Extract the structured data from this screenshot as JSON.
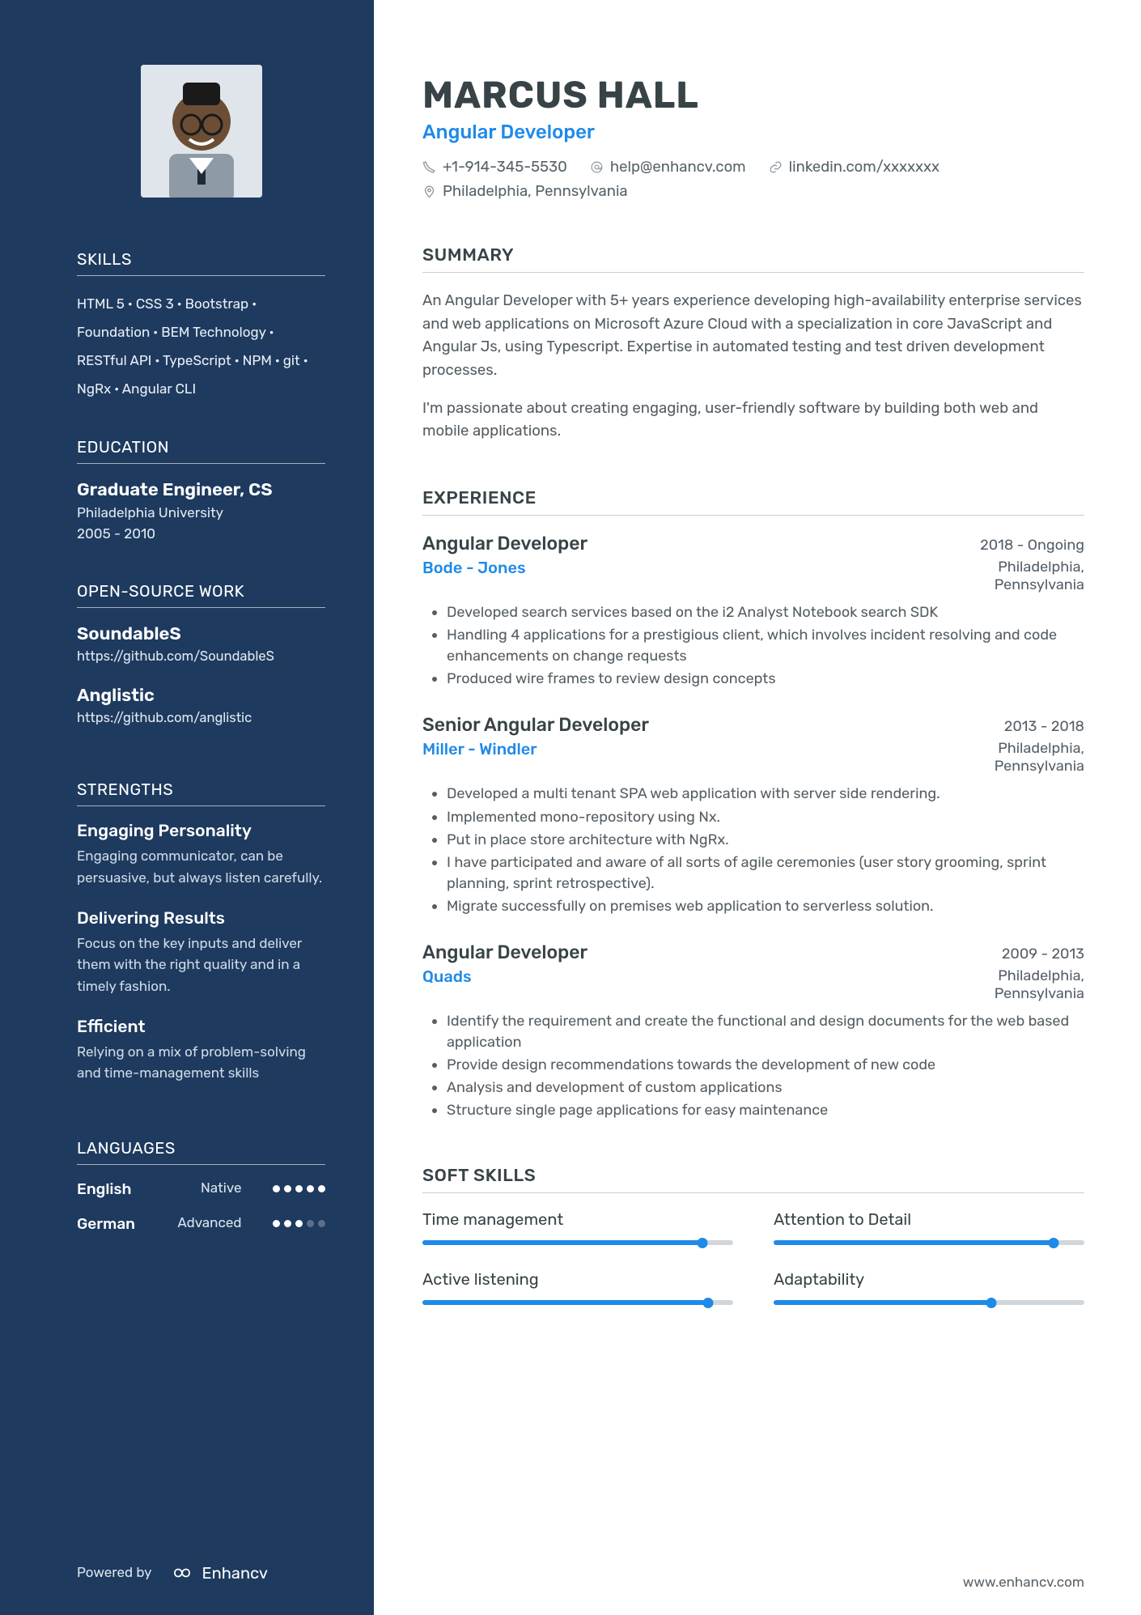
{
  "header": {
    "name": "MARCUS HALL",
    "title": "Angular Developer",
    "phone": "+1-914-345-5530",
    "email": "help@enhancv.com",
    "linkedin": "linkedin.com/xxxxxxx",
    "location": "Philadelphia, Pennsylvania"
  },
  "sidebar": {
    "skills_heading": "SKILLS",
    "skills": "HTML 5 · CSS 3 · Bootstrap · Foundation · BEM Technology · RESTful API · TypeScript · NPM · git · NgRx · Angular CLI",
    "education_heading": "EDUCATION",
    "education": {
      "degree": "Graduate Engineer, CS",
      "school": "Philadelphia University",
      "dates": "2005 - 2010"
    },
    "opensource_heading": "OPEN-SOURCE WORK",
    "opensource": [
      {
        "name": "SoundableS",
        "url": "https://github.com/SoundableS"
      },
      {
        "name": "Anglistic",
        "url": "https://github.com/anglistic"
      }
    ],
    "strengths_heading": "STRENGTHS",
    "strengths": [
      {
        "title": "Engaging Personality",
        "desc": "Engaging communicator, can be persuasive, but always listen carefully."
      },
      {
        "title": "Delivering Results",
        "desc": "Focus on the key inputs and deliver them with the right quality and in a timely fashion."
      },
      {
        "title": "Efficient",
        "desc": "Relying on a mix of problem-solving and time-management skills"
      }
    ],
    "languages_heading": "LANGUAGES",
    "languages": [
      {
        "name": "English",
        "level": "Native",
        "dots": 5
      },
      {
        "name": "German",
        "level": "Advanced",
        "dots": 3
      }
    ],
    "powered_by": "Powered by",
    "brand": "Enhancv"
  },
  "main": {
    "summary_heading": "SUMMARY",
    "summary": [
      "An Angular Developer with 5+ years experience developing high-availability enterprise services and web applications on Microsoft Azure Cloud with a specialization in core JavaScript and Angular Js, using Typescript. Expertise in automated testing and test driven development processes.",
      "I'm passionate about creating engaging, user-friendly software by building both web and mobile applications."
    ],
    "experience_heading": "EXPERIENCE",
    "experience": [
      {
        "title": "Angular Developer",
        "dates": "2018 - Ongoing",
        "company": "Bode - Jones",
        "location": "Philadelphia, Pennsylvania",
        "bullets": [
          "Developed search services based on the i2 Analyst Notebook search SDK",
          "Handling 4 applications for a prestigious client, which involves incident resolving and code enhancements on change requests",
          "Produced wire frames to review design concepts"
        ]
      },
      {
        "title": "Senior Angular Developer",
        "dates": "2013 - 2018",
        "company": "Miller - Windler",
        "location": "Philadelphia, Pennsylvania",
        "bullets": [
          "Developed a multi tenant SPA web application with server side rendering.",
          "Implemented mono-repository using Nx.",
          "Put in place store architecture with NgRx.",
          "I have participated and aware of all sorts of agile ceremonies (user story grooming, sprint planning, sprint retrospective).",
          "Migrate successfully on premises web application to serverless solution."
        ]
      },
      {
        "title": "Angular Developer",
        "dates": "2009 - 2013",
        "company": "Quads",
        "location": "Philadelphia, Pennsylvania",
        "bullets": [
          "Identify the requirement and create the functional and design documents for the web based application",
          "Provide design recommendations towards the development of new code",
          "Analysis and development of custom applications",
          "Structure single page applications for easy maintenance"
        ]
      }
    ],
    "softskills_heading": "SOFT SKILLS",
    "softskills": [
      {
        "label": "Time management",
        "pct": 90
      },
      {
        "label": "Attention to Detail",
        "pct": 90
      },
      {
        "label": "Active listening",
        "pct": 92
      },
      {
        "label": "Adaptability",
        "pct": 70
      }
    ],
    "footer_url": "www.enhancv.com"
  }
}
